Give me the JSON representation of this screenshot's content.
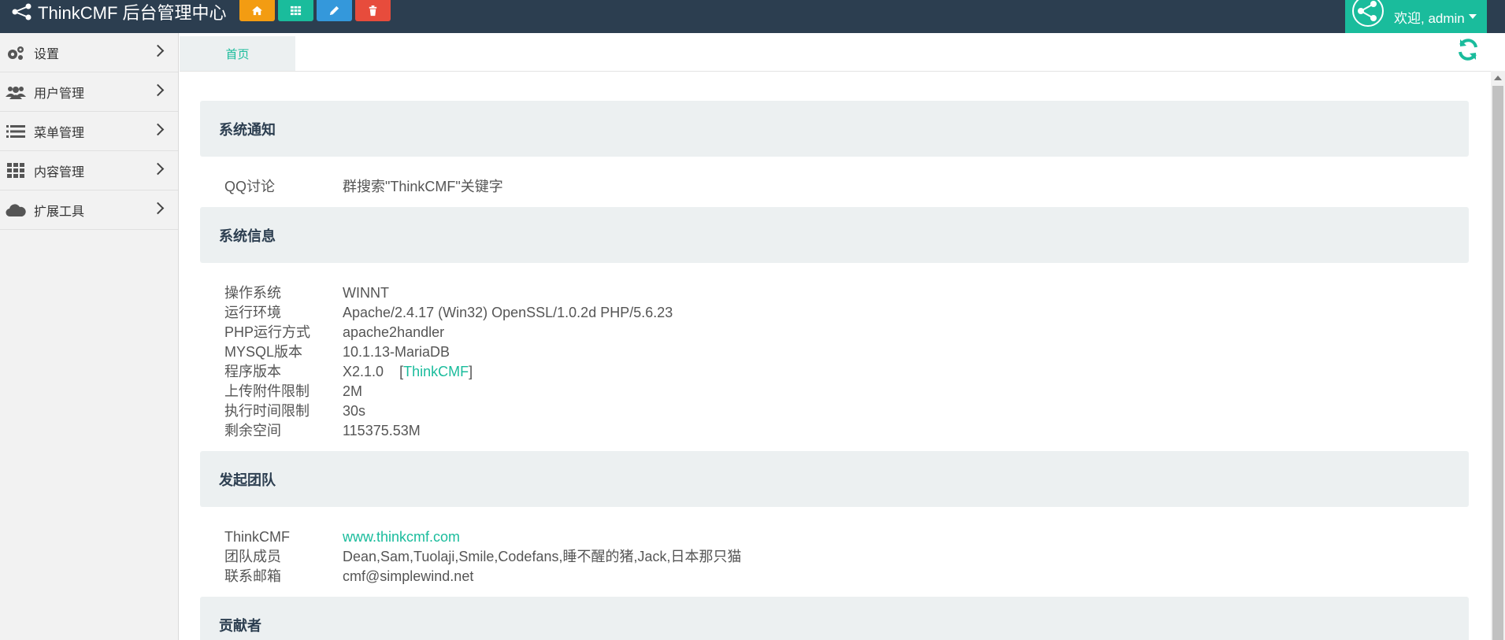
{
  "header": {
    "brand": "ThinkCMF 后台管理中心",
    "quick_buttons": [
      {
        "icon": "home-icon",
        "color": "#f39c12"
      },
      {
        "icon": "grid-icon",
        "color": "#1abc9c"
      },
      {
        "icon": "pencil-icon",
        "color": "#3498db"
      },
      {
        "icon": "trash-icon",
        "color": "#e74c3c"
      }
    ],
    "user": {
      "welcome": "欢迎, admin"
    }
  },
  "sidebar": {
    "items": [
      {
        "label": "设置",
        "icon": "gears-icon"
      },
      {
        "label": "用户管理",
        "icon": "users-icon"
      },
      {
        "label": "菜单管理",
        "icon": "list-icon"
      },
      {
        "label": "内容管理",
        "icon": "th-icon"
      },
      {
        "label": "扩展工具",
        "icon": "cloud-icon"
      }
    ]
  },
  "tabs": [
    {
      "label": "首页"
    }
  ],
  "sections": {
    "notice": {
      "title": "系统通知",
      "rows": [
        {
          "k": "QQ讨论",
          "v": "群搜索\"ThinkCMF\"关键字"
        }
      ]
    },
    "sysinfo": {
      "title": "系统信息",
      "rows": [
        {
          "k": "操作系统",
          "v": "WINNT"
        },
        {
          "k": "运行环境",
          "v": "Apache/2.4.17 (Win32) OpenSSL/1.0.2d PHP/5.6.23"
        },
        {
          "k": "PHP运行方式",
          "v": "apache2handler"
        },
        {
          "k": "MYSQL版本",
          "v": "10.1.13-MariaDB"
        },
        {
          "k": "程序版本",
          "v": "X2.1.0",
          "v_open": "[",
          "v_link": "ThinkCMF",
          "v_close": "]"
        },
        {
          "k": "上传附件限制",
          "v": "2M"
        },
        {
          "k": "执行时间限制",
          "v": "30s"
        },
        {
          "k": "剩余空间",
          "v": "115375.53M"
        }
      ]
    },
    "team": {
      "title": "发起团队",
      "rows": [
        {
          "k": "ThinkCMF",
          "v": "www.thinkcmf.com"
        },
        {
          "k": "团队成员",
          "v": "Dean,Sam,Tuolaji,Smile,Codefans,睡不醒的猪,Jack,日本那只猫"
        },
        {
          "k": "联系邮箱",
          "v": "cmf@simplewind.net"
        }
      ]
    },
    "contrib": {
      "title": "贡献者"
    }
  }
}
